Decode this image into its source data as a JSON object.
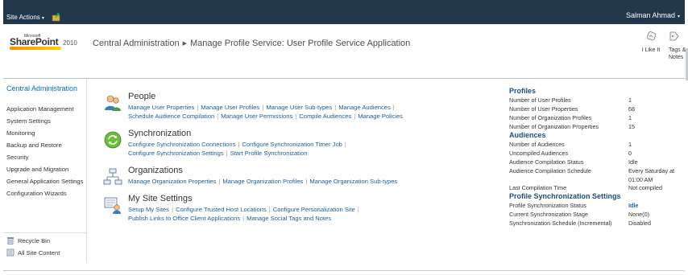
{
  "topbar": {
    "site_actions": "Site Actions",
    "user": "Salman Ahmad"
  },
  "header": {
    "logo": {
      "microsoft": "Microsoft",
      "product": "SharePoint",
      "year": "2010"
    },
    "breadcrumb": {
      "root": "Central Administration",
      "current": "Manage Profile Service: User Profile Service Application"
    },
    "like_label": "I Like It",
    "tags_label": "Tags & Notes"
  },
  "leftnav": {
    "home": "Central Administration",
    "items": [
      "Application Management",
      "System Settings",
      "Monitoring",
      "Backup and Restore",
      "Security",
      "Upgrade and Migration",
      "General Application Settings",
      "Configuration Wizards"
    ],
    "recycle_bin": "Recycle Bin",
    "all_site_content": "All Site Content"
  },
  "sections": {
    "people": {
      "title": "People",
      "links": [
        "Manage User Properties",
        "Manage User Profiles",
        "Manage User Sub-types",
        "Manage Audiences",
        "Schedule Audience Compilation",
        "Manage User Permissions",
        "Compile Audiences",
        "Manage Policies"
      ]
    },
    "sync": {
      "title": "Synchronization",
      "links": [
        "Configure Synchronization Connections",
        "Configure Synchronization Timer Job",
        "Configure Synchronization Settings",
        "Start Profile Synchronization"
      ]
    },
    "orgs": {
      "title": "Organizations",
      "links": [
        "Manage Organization Properties",
        "Manage Organization Profiles",
        "Manage Organization Sub-types"
      ]
    },
    "mysite": {
      "title": "My Site Settings",
      "links": [
        "Setup My Sites",
        "Configure Trusted Host Locations",
        "Configure Personalization Site",
        "Publish Links to Office Client Applications",
        "Manage Social Tags and Notes"
      ]
    }
  },
  "stats": {
    "profiles": {
      "heading": "Profiles",
      "rows": [
        {
          "k": "Number of User Profiles",
          "v": "1"
        },
        {
          "k": "Number of User Properties",
          "v": "68"
        },
        {
          "k": "Number of Organization Profiles",
          "v": "1"
        },
        {
          "k": "Number of Organization Properties",
          "v": "15"
        }
      ]
    },
    "audiences": {
      "heading": "Audiences",
      "rows": [
        {
          "k": "Number of Audiences",
          "v": "1"
        },
        {
          "k": "Uncompiled Audiences",
          "v": "0"
        },
        {
          "k": "Audience Compilation Status",
          "v": "Idle"
        },
        {
          "k": "Audience Compilation Schedule",
          "v": "Every Saturday at",
          "v2": "01:00 AM"
        },
        {
          "k": "Last Compilation Time",
          "v": "Not compiled"
        }
      ]
    },
    "sync": {
      "heading": "Profile Synchronization Settings",
      "rows": [
        {
          "k": "Profile Synchronization Status",
          "v": "Idle"
        },
        {
          "k": "Current Synchronization Stage",
          "v": "None(0)"
        },
        {
          "k": "Synchronization Schedule (Incremental)",
          "v": "Disabled"
        }
      ]
    }
  }
}
